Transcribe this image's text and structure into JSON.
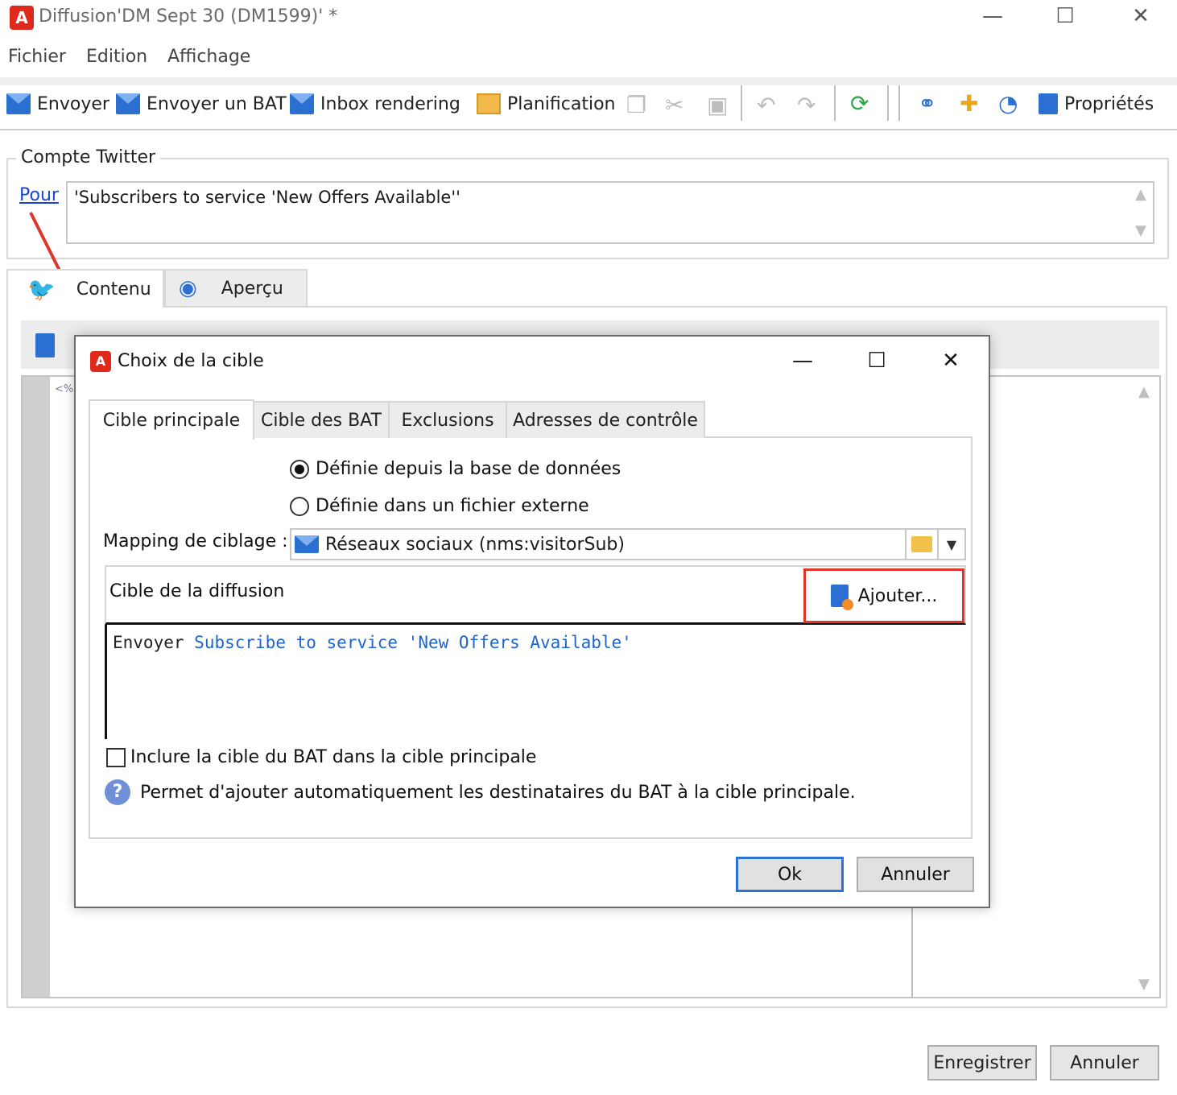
{
  "window": {
    "title": "Diffusion'DM Sept 30 (DM1599)' *",
    "logo": "A",
    "controls": {
      "minimize": "—",
      "maximize": "☐",
      "close": "✕"
    }
  },
  "menu": [
    "Fichier",
    "Edition",
    "Affichage"
  ],
  "toolbar": {
    "envoyer": "Envoyer",
    "envoyer_bat": "Envoyer un BAT",
    "inbox": "Inbox rendering",
    "planification": "Planification",
    "proprietes": "Propriétés"
  },
  "compte": {
    "legend": "Compte Twitter",
    "pour_label": "Pour",
    "pour_value": "'Subscribers to service 'New Offers Available''"
  },
  "tabs": [
    {
      "label": "Contenu",
      "icon": "twitter-icon"
    },
    {
      "label": "Aperçu",
      "icon": "eye-icon"
    }
  ],
  "editor": {
    "gutter_text": "<%"
  },
  "bottom_buttons": {
    "save": "Enregistrer",
    "cancel": "Annuler"
  },
  "dialog": {
    "title": "Choix de la cible",
    "tabs": [
      "Cible principale",
      "Cible des BAT",
      "Exclusions",
      "Adresses de contrôle"
    ],
    "radio_db": "Définie depuis la base de données",
    "radio_file": "Définie dans un fichier externe",
    "mapping_label": "Mapping de ciblage :",
    "mapping_value": "Réseaux sociaux (nms:visitorSub)",
    "cible_label": "Cible de la diffusion",
    "ajouter": "Ajouter...",
    "envoyer_prefix": "Envoyer",
    "envoyer_link": "Subscribe to service 'New Offers Available'",
    "bat_checkbox": "Inclure la cible du BAT dans la cible principale",
    "help_text": "Permet d'ajouter automatiquement les destinataires du BAT à la cible principale.",
    "ok": "Ok",
    "annuler": "Annuler"
  },
  "colors": {
    "accent_red": "#e0291d",
    "link_blue": "#1a44d8",
    "highlight_red": "#e0352a",
    "ok_border": "#2a72d6"
  }
}
